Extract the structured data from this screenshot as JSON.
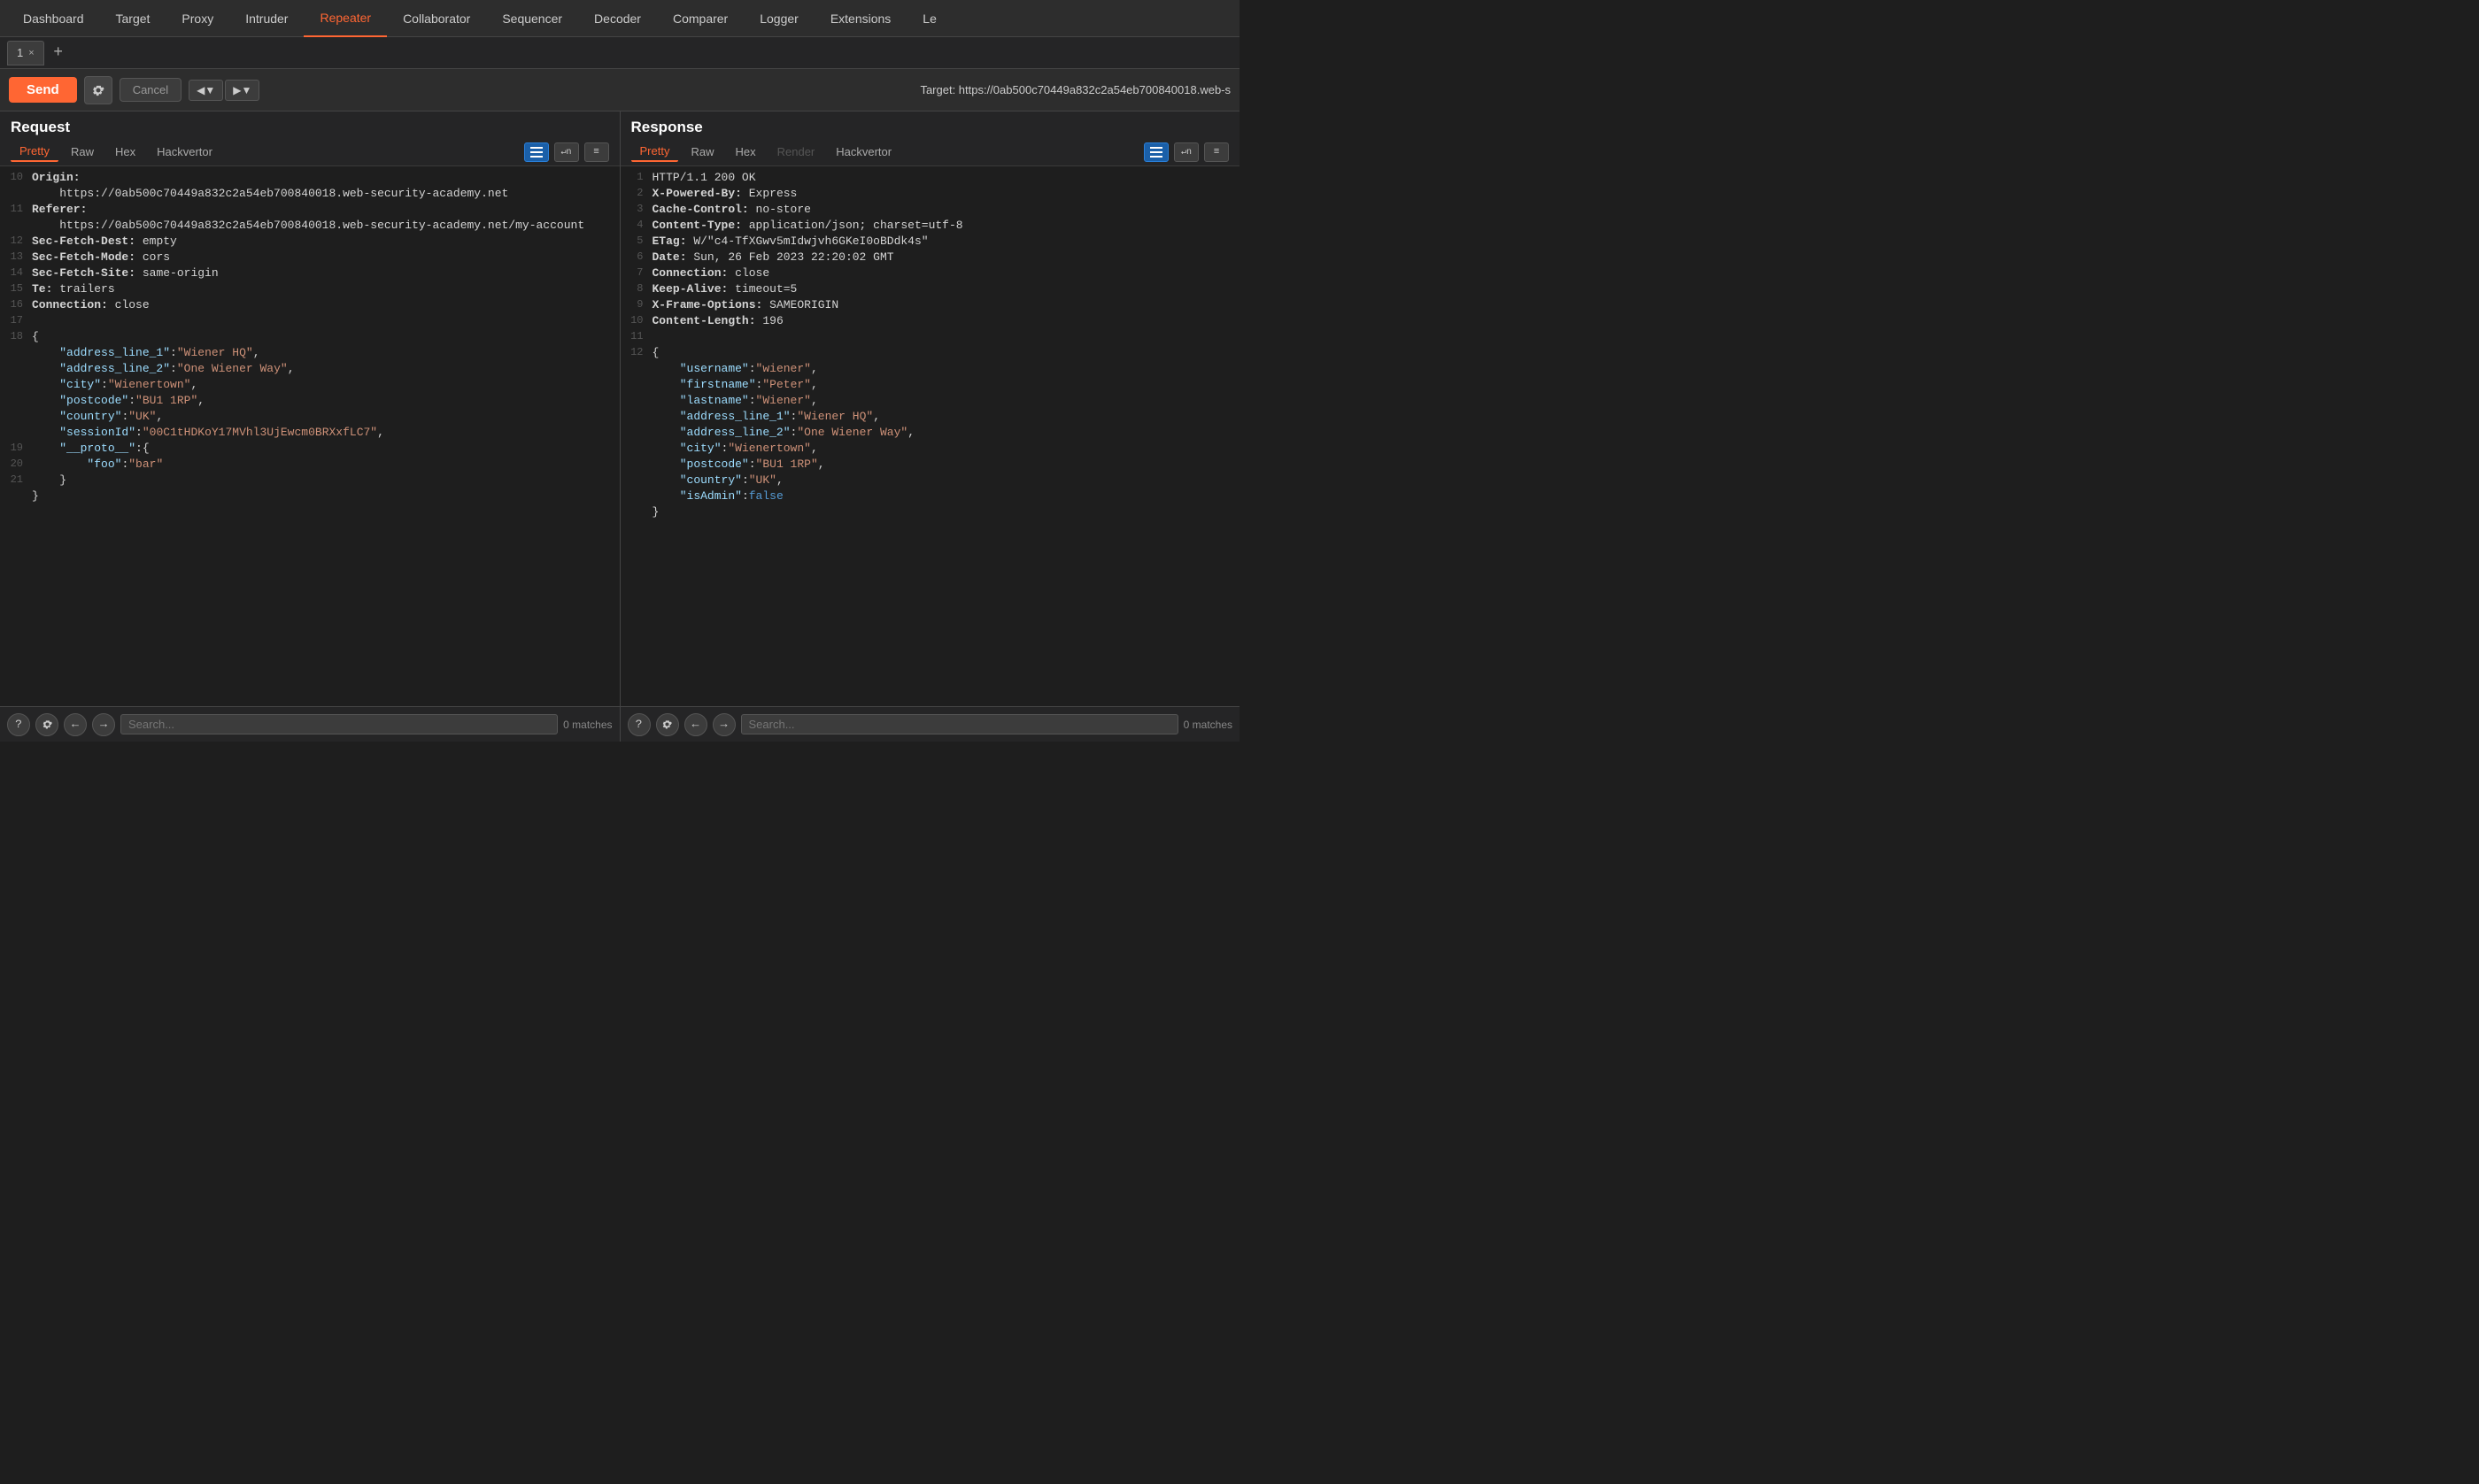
{
  "nav": {
    "items": [
      {
        "label": "Dashboard",
        "active": false
      },
      {
        "label": "Target",
        "active": false
      },
      {
        "label": "Proxy",
        "active": false
      },
      {
        "label": "Intruder",
        "active": false
      },
      {
        "label": "Repeater",
        "active": true
      },
      {
        "label": "Collaborator",
        "active": false
      },
      {
        "label": "Sequencer",
        "active": false
      },
      {
        "label": "Decoder",
        "active": false
      },
      {
        "label": "Comparer",
        "active": false
      },
      {
        "label": "Logger",
        "active": false
      },
      {
        "label": "Extensions",
        "active": false
      },
      {
        "label": "Le",
        "active": false
      }
    ]
  },
  "tabs": {
    "items": [
      {
        "label": "1",
        "active": true
      }
    ],
    "add_label": "+"
  },
  "toolbar": {
    "send_label": "Send",
    "cancel_label": "Cancel",
    "target_text": "Target: https://0ab500c70449a832c2a54eb700840018.web-s"
  },
  "request": {
    "title": "Request",
    "tabs": [
      "Pretty",
      "Raw",
      "Hex",
      "Hackvertor"
    ],
    "active_tab": "Pretty",
    "lines": [
      {
        "num": 10,
        "html": "<span class='header-name'>Origin:</span>"
      },
      {
        "num": "",
        "html": "    <span class='header-val'>https://0ab500c70449a832c2a54eb700840018.web-security-academy.net</span>"
      },
      {
        "num": 11,
        "html": "<span class='header-name'>Referer:</span>"
      },
      {
        "num": "",
        "html": "    <span class='header-val'>https://0ab500c70449a832c2a54eb700840018.web-security-academy.net/my-account</span>"
      },
      {
        "num": 12,
        "html": "<span class='header-name'>Sec-Fetch-Dest:</span> <span class='header-val'>empty</span>"
      },
      {
        "num": 13,
        "html": "<span class='header-name'>Sec-Fetch-Mode:</span> <span class='header-val'>cors</span>"
      },
      {
        "num": 14,
        "html": "<span class='header-name'>Sec-Fetch-Site:</span> <span class='header-val'>same-origin</span>"
      },
      {
        "num": 15,
        "html": "<span class='header-name'>Te:</span> <span class='header-val'>trailers</span>"
      },
      {
        "num": 16,
        "html": "<span class='header-name'>Connection:</span> <span class='header-val'>close</span>"
      },
      {
        "num": 17,
        "html": ""
      },
      {
        "num": 18,
        "html": "<span class='json-punct'>{</span>"
      },
      {
        "num": "",
        "html": "    <span class='json-key'>\"address_line_1\"</span><span class='json-punct'>:</span><span class='json-string'>\"Wiener HQ\"</span><span class='json-punct'>,</span>"
      },
      {
        "num": "",
        "html": "    <span class='json-key'>\"address_line_2\"</span><span class='json-punct'>:</span><span class='json-string'>\"One Wiener Way\"</span><span class='json-punct'>,</span>"
      },
      {
        "num": "",
        "html": "    <span class='json-key'>\"city\"</span><span class='json-punct'>:</span><span class='json-string'>\"Wienertown\"</span><span class='json-punct'>,</span>"
      },
      {
        "num": "",
        "html": "    <span class='json-key'>\"postcode\"</span><span class='json-punct'>:</span><span class='json-string'>\"BU1 1RP\"</span><span class='json-punct'>,</span>"
      },
      {
        "num": "",
        "html": "    <span class='json-key'>\"country\"</span><span class='json-punct'>:</span><span class='json-string'>\"UK\"</span><span class='json-punct'>,</span>"
      },
      {
        "num": "",
        "html": "    <span class='json-key'>\"sessionId\"</span><span class='json-punct'>:</span><span class='json-string'>\"00C1tHDKoY17MVhl3UjEwcm0BRXxfLC7\"</span><span class='json-punct'>,</span>"
      },
      {
        "num": 19,
        "html": "    <span class='json-key'>\"__proto__\"</span><span class='json-punct'>:{</span>"
      },
      {
        "num": 20,
        "html": "        <span class='json-key'>\"foo\"</span><span class='json-punct'>:</span><span class='json-string'>\"bar\"</span>"
      },
      {
        "num": 21,
        "html": "    <span class='json-punct'>}</span>"
      },
      {
        "num": "",
        "html": "<span class='json-punct'>}</span>"
      }
    ],
    "search_placeholder": "Search...",
    "matches": "0 matches"
  },
  "response": {
    "title": "Response",
    "tabs": [
      "Pretty",
      "Raw",
      "Hex",
      "Render",
      "Hackvertor"
    ],
    "active_tab": "Pretty",
    "lines": [
      {
        "num": 1,
        "html": "<span class='http-status'>HTTP/1.1 200 OK</span>"
      },
      {
        "num": 2,
        "html": "<span class='header-name'>X-Powered-By:</span> <span class='header-val'>Express</span>"
      },
      {
        "num": 3,
        "html": "<span class='header-name'>Cache-Control:</span> <span class='header-val'>no-store</span>"
      },
      {
        "num": 4,
        "html": "<span class='header-name'>Content-Type:</span> <span class='header-val'>application/json; charset=utf-8</span>"
      },
      {
        "num": 5,
        "html": "<span class='header-name'>ETag:</span> <span class='header-val'>W/\"c4-TfXGwv5mIdwjvh6GKeI0oBDdk4s\"</span>"
      },
      {
        "num": 6,
        "html": "<span class='header-name'>Date:</span> <span class='header-val'>Sun, 26 Feb 2023 22:20:02 GMT</span>"
      },
      {
        "num": 7,
        "html": "<span class='header-name'>Connection:</span> <span class='header-val'>close</span>"
      },
      {
        "num": 8,
        "html": "<span class='header-name'>Keep-Alive:</span> <span class='header-val'>timeout=5</span>"
      },
      {
        "num": 9,
        "html": "<span class='header-name'>X-Frame-Options:</span> <span class='header-val'>SAMEORIGIN</span>"
      },
      {
        "num": 10,
        "html": "<span class='header-name'>Content-Length:</span> <span class='header-val'>196</span>"
      },
      {
        "num": 11,
        "html": ""
      },
      {
        "num": 12,
        "html": "<span class='json-punct'>{</span>"
      },
      {
        "num": "",
        "html": "    <span class='json-key'>\"username\"</span><span class='json-punct'>:</span><span class='json-string'>\"wiener\"</span><span class='json-punct'>,</span>"
      },
      {
        "num": "",
        "html": "    <span class='json-key'>\"firstname\"</span><span class='json-punct'>:</span><span class='json-string'>\"Peter\"</span><span class='json-punct'>,</span>"
      },
      {
        "num": "",
        "html": "    <span class='json-key'>\"lastname\"</span><span class='json-punct'>:</span><span class='json-string'>\"Wiener\"</span><span class='json-punct'>,</span>"
      },
      {
        "num": "",
        "html": "    <span class='json-key'>\"address_line_1\"</span><span class='json-punct'>:</span><span class='json-string'>\"Wiener HQ\"</span><span class='json-punct'>,</span>"
      },
      {
        "num": "",
        "html": "    <span class='json-key'>\"address_line_2\"</span><span class='json-punct'>:</span><span class='json-string'>\"One Wiener Way\"</span><span class='json-punct'>,</span>"
      },
      {
        "num": "",
        "html": "    <span class='json-key'>\"city\"</span><span class='json-punct'>:</span><span class='json-string'>\"Wienertown\"</span><span class='json-punct'>,</span>"
      },
      {
        "num": "",
        "html": "    <span class='json-key'>\"postcode\"</span><span class='json-punct'>:</span><span class='json-string'>\"BU1 1RP\"</span><span class='json-punct'>,</span>"
      },
      {
        "num": "",
        "html": "    <span class='json-key'>\"country\"</span><span class='json-punct'>:</span><span class='json-string'>\"UK\"</span><span class='json-punct'>,</span>"
      },
      {
        "num": "",
        "html": "    <span class='json-key'>\"isAdmin\"</span><span class='json-punct'>:</span><span class='json-bool'>false</span>"
      },
      {
        "num": "",
        "html": "<span class='json-punct'>}</span>"
      }
    ],
    "search_placeholder": "Search...",
    "matches": "0 matches"
  }
}
